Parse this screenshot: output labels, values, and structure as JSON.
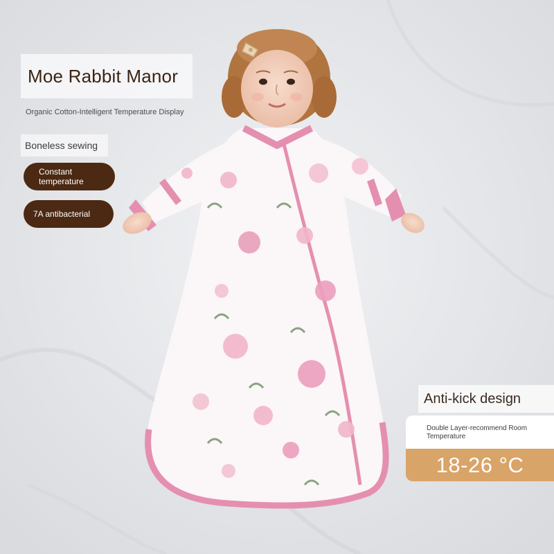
{
  "brand": {
    "title": "Moe Rabbit Manor"
  },
  "subtitle": "Organic Cotton-Intelligent Temperature Display",
  "features": {
    "boneless": "Boneless sewing",
    "constant": "Constant temperature",
    "antibacterial": "7A antibacterial"
  },
  "anti_kick": "Anti-kick design",
  "temperature": {
    "note": "Double Layer-recommend Room Temperature",
    "range": "18-26 °C"
  },
  "colors": {
    "accent_brown": "#4b2912",
    "temp_band": "#d9a468",
    "garment_pink": "#e58fb0",
    "sheet": "#e9eaec"
  },
  "icons": [
    "hair-clip-icon"
  ]
}
